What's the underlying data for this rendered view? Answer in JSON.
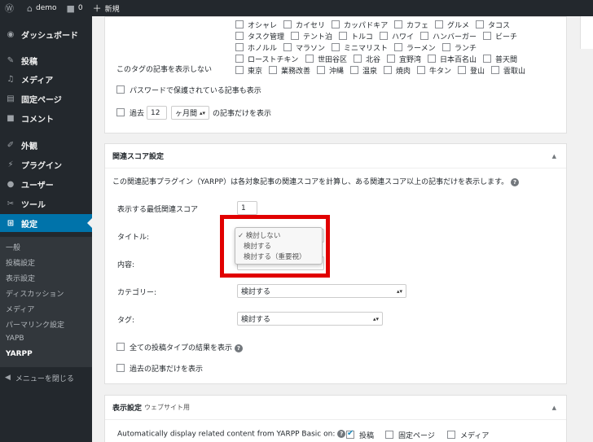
{
  "adminbar": {
    "site": "demo",
    "comments": "0",
    "new": "新規"
  },
  "sidebar": {
    "items": [
      {
        "label": "ダッシュボード",
        "icon": "dashboard-icon",
        "glyph": "◉"
      },
      {
        "label": "投稿",
        "icon": "pin-icon",
        "glyph": "✎"
      },
      {
        "label": "メディア",
        "icon": "media-icon",
        "glyph": "♫"
      },
      {
        "label": "固定ページ",
        "icon": "page-icon",
        "glyph": "▤"
      },
      {
        "label": "コメント",
        "icon": "comment-icon",
        "glyph": "■"
      },
      {
        "label": "外観",
        "icon": "appearance-icon",
        "glyph": "✐"
      },
      {
        "label": "プラグイン",
        "icon": "plugin-icon",
        "glyph": "⚡"
      },
      {
        "label": "ユーザー",
        "icon": "users-icon",
        "glyph": "●"
      },
      {
        "label": "ツール",
        "icon": "tools-icon",
        "glyph": "✂"
      },
      {
        "label": "設定",
        "icon": "settings-icon",
        "glyph": "⊞"
      }
    ],
    "submenu": [
      "一般",
      "投稿設定",
      "表示設定",
      "ディスカッション",
      "メディア",
      "パーマリンク設定",
      "YAPB",
      "YARPP"
    ],
    "collapse": "メニューを閉じる"
  },
  "tags": {
    "row1": [
      "オシャレ",
      "カイセリ",
      "カッパドキア",
      "カフェ",
      "グルメ",
      "タコス"
    ],
    "row2": [
      "タスク管理",
      "テント泊",
      "トルコ",
      "ハワイ",
      "ハンバーガー",
      "ビーチ"
    ],
    "row3": [
      "ホノルル",
      "マラソン",
      "ミニマリスト",
      "ラーメン",
      "ランチ"
    ],
    "row4": [
      "ローストチキン",
      "世田谷区",
      "北谷",
      "宜野湾",
      "日本百名山",
      "普天間"
    ],
    "row5": [
      "東京",
      "業務改善",
      "沖縄",
      "温泉",
      "焼肉",
      "牛タン",
      "登山",
      "雲取山"
    ],
    "label": "このタグの記事を表示しない"
  },
  "options": {
    "password": "パスワードで保護されている記事も表示",
    "past_prefix": "過去",
    "past_value": "12",
    "past_unit": "ヶ月間",
    "past_suffix": "の記事だけを表示"
  },
  "relevance": {
    "title": "関連スコア設定",
    "desc": "この関連記事プラグイン（YARPP）は各対象記事の関連スコアを計算し、ある関連スコア以上の記事だけを表示します。",
    "min_score_label": "表示する最低関連スコア",
    "min_score_value": "1",
    "title_label": "タイトル:",
    "content_label": "内容:",
    "category_label": "カテゴリー:",
    "tag_label": "タグ:",
    "category_value": "検討する",
    "tag_value": "検討する",
    "dropdown": [
      "検討しない",
      "検討する",
      "検討する（重要視）"
    ],
    "all_types": "全ての投稿タイプの結果を表示",
    "past_only": "過去の記事だけを表示"
  },
  "display": {
    "title": "表示設定",
    "subtitle": "ウェブサイト用",
    "auto_label": "Automatically display related content from YARPP Basic on:",
    "targets": [
      "投稿",
      "固定ページ",
      "メディア"
    ]
  }
}
